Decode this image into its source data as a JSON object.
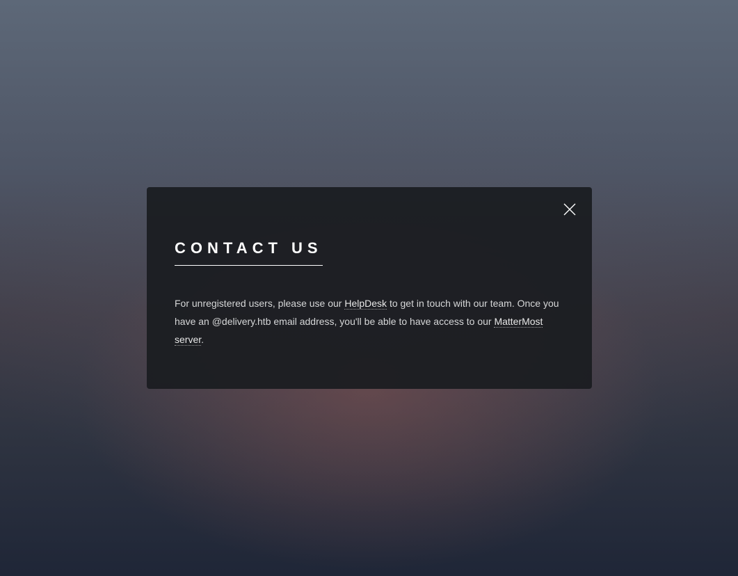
{
  "modal": {
    "title": "CONTACT US",
    "close_icon": "close-icon",
    "text_part1": "For unregistered users, please use our ",
    "helpdesk_link": "HelpDesk",
    "text_part2": " to get in touch with our team. Once you have an @delivery.htb email address, you'll be able to have access to our ",
    "mattermost_link": "MatterMost server",
    "text_part3": "."
  },
  "colors": {
    "modal_bg": "#1b1d21",
    "text": "#d6d7d8",
    "title": "#ffffff"
  }
}
